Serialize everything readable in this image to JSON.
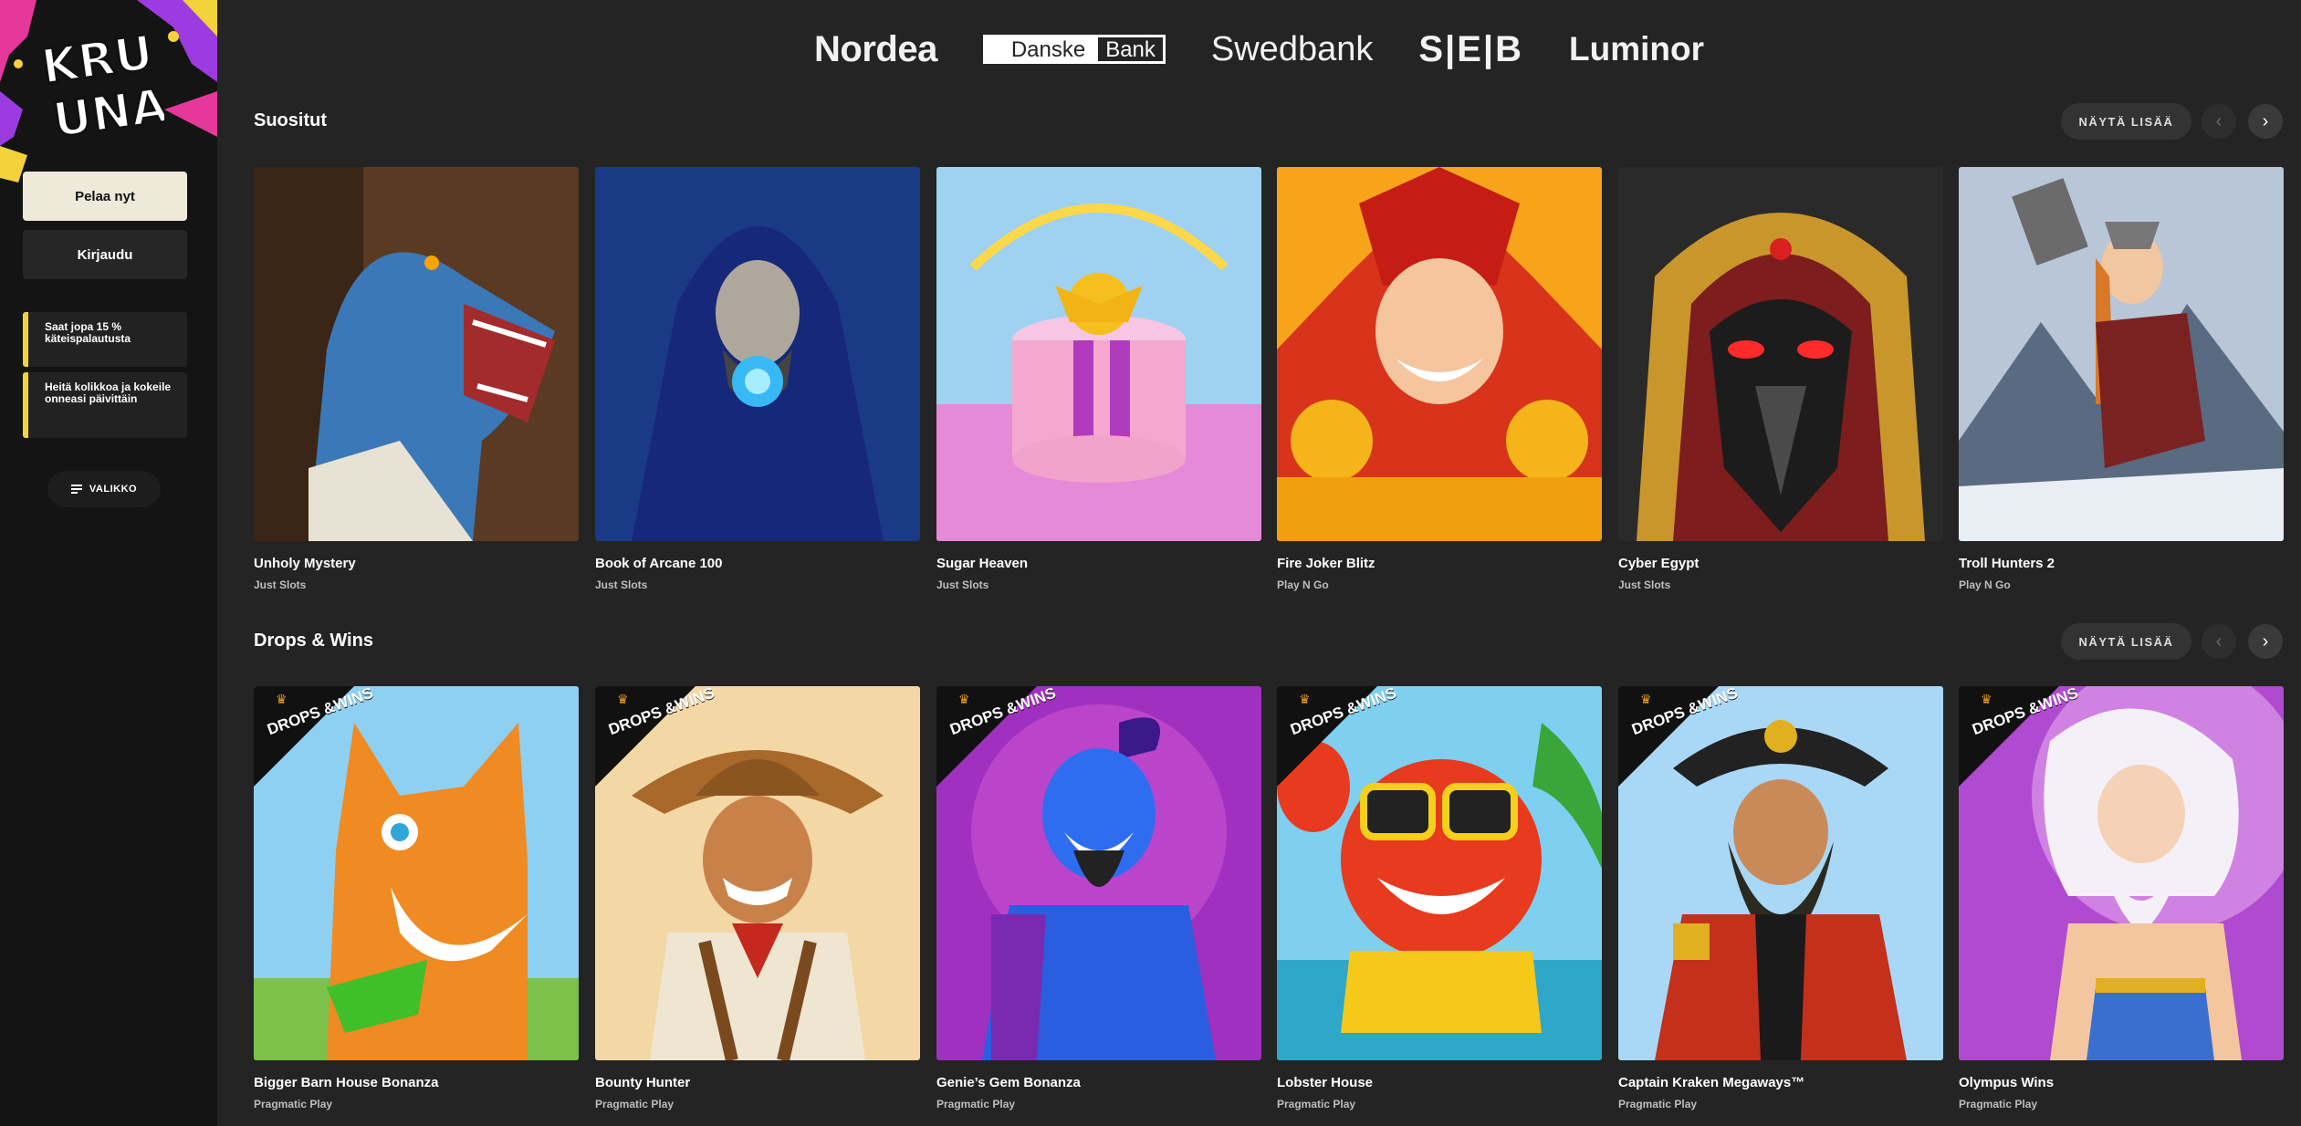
{
  "sidebar": {
    "logo_text": "KRU UNA",
    "play_label": "Pelaa nyt",
    "login_label": "Kirjaudu",
    "promos": [
      "Saat jopa 15 % käteispalautusta",
      "Heitä kolikkoa ja kokeile onneasi päivittäin"
    ],
    "menu_label": "VALIKKO"
  },
  "banks": [
    "Nordea",
    "Danske",
    "Bank",
    "Swedbank",
    "S|E|B",
    "Luminor"
  ],
  "sections": [
    {
      "title": "Suositut",
      "more_label": "NÄYTÄ LISÄÄ",
      "games": [
        {
          "name": "Unholy Mystery",
          "provider": "Just Slots"
        },
        {
          "name": "Book of Arcane 100",
          "provider": "Just Slots"
        },
        {
          "name": "Sugar Heaven",
          "provider": "Just Slots"
        },
        {
          "name": "Fire Joker Blitz",
          "provider": "Play N Go"
        },
        {
          "name": "Cyber Egypt",
          "provider": "Just Slots"
        },
        {
          "name": "Troll Hunters 2",
          "provider": "Play N Go"
        }
      ]
    },
    {
      "title": "Drops & Wins",
      "more_label": "NÄYTÄ LISÄÄ",
      "badge_text": "DROPS &WINS",
      "games": [
        {
          "name": "Bigger Barn House Bonanza",
          "provider": "Pragmatic Play"
        },
        {
          "name": "Bounty Hunter",
          "provider": "Pragmatic Play"
        },
        {
          "name": "Genie’s Gem Bonanza",
          "provider": "Pragmatic Play"
        },
        {
          "name": "Lobster House",
          "provider": "Pragmatic Play"
        },
        {
          "name": "Captain Kraken Megaways™",
          "provider": "Pragmatic Play"
        },
        {
          "name": "Olympus Wins",
          "provider": "Pragmatic Play"
        }
      ]
    }
  ],
  "colors": {
    "accent_yellow": "#f3d23a",
    "background": "#242424",
    "sidebar": "#141414",
    "play_button": "#efe9da"
  },
  "icons": {
    "menu": "hamburger-icon",
    "prev": "chevron-left-icon",
    "next": "chevron-right-icon"
  }
}
